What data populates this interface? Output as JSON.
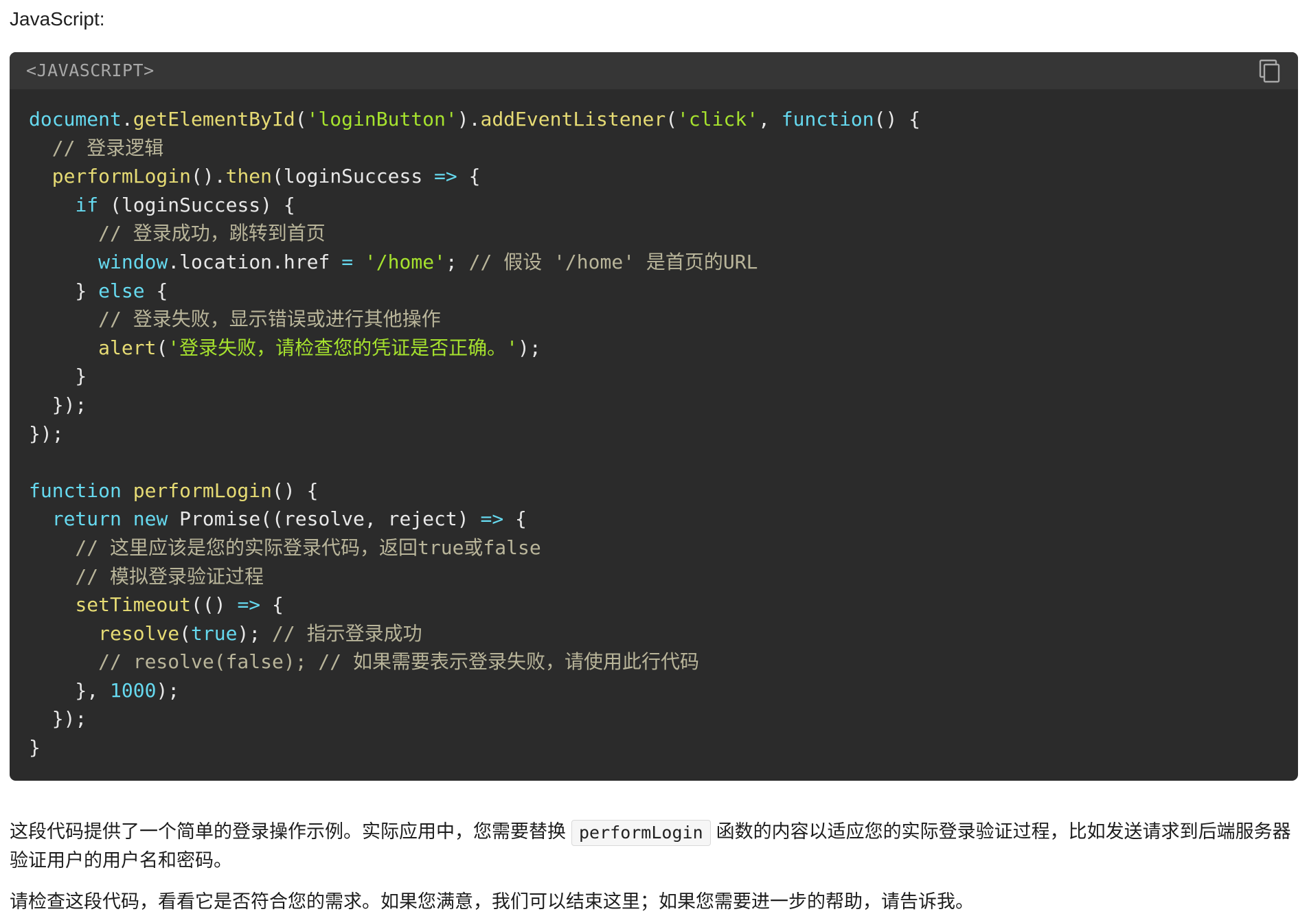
{
  "header": {
    "language_intro": "JavaScript:"
  },
  "code_block": {
    "language_label": "<JAVASCRIPT>",
    "copy_icon": "copy-icon",
    "lines": [
      [
        {
          "text": "document",
          "role": "blue"
        },
        {
          "text": ".",
          "role": "default"
        },
        {
          "text": "getElementById",
          "role": "yellow"
        },
        {
          "text": "(",
          "role": "default"
        },
        {
          "text": "'loginButton'",
          "role": "green"
        },
        {
          "text": ").",
          "role": "default"
        },
        {
          "text": "addEventListener",
          "role": "yellow"
        },
        {
          "text": "(",
          "role": "default"
        },
        {
          "text": "'click'",
          "role": "green"
        },
        {
          "text": ", ",
          "role": "default"
        },
        {
          "text": "function",
          "role": "blue"
        },
        {
          "text": "() {",
          "role": "default"
        }
      ],
      [
        {
          "text": "  // 登录逻辑",
          "role": "comment"
        }
      ],
      [
        {
          "text": "  ",
          "role": "default"
        },
        {
          "text": "performLogin",
          "role": "yellow"
        },
        {
          "text": "().",
          "role": "default"
        },
        {
          "text": "then",
          "role": "yellow"
        },
        {
          "text": "(loginSuccess ",
          "role": "default"
        },
        {
          "text": "=>",
          "role": "blue"
        },
        {
          "text": " {",
          "role": "default"
        }
      ],
      [
        {
          "text": "    ",
          "role": "default"
        },
        {
          "text": "if",
          "role": "blue"
        },
        {
          "text": " (loginSuccess) {",
          "role": "default"
        }
      ],
      [
        {
          "text": "      // 登录成功，跳转到首页",
          "role": "comment"
        }
      ],
      [
        {
          "text": "      ",
          "role": "default"
        },
        {
          "text": "window",
          "role": "blue"
        },
        {
          "text": ".location.href ",
          "role": "default"
        },
        {
          "text": "=",
          "role": "blue"
        },
        {
          "text": " ",
          "role": "default"
        },
        {
          "text": "'/home'",
          "role": "green"
        },
        {
          "text": "; ",
          "role": "default"
        },
        {
          "text": "// 假设 '/home' 是首页的URL",
          "role": "comment"
        }
      ],
      [
        {
          "text": "    } ",
          "role": "default"
        },
        {
          "text": "else",
          "role": "blue"
        },
        {
          "text": " {",
          "role": "default"
        }
      ],
      [
        {
          "text": "      // 登录失败，显示错误或进行其他操作",
          "role": "comment"
        }
      ],
      [
        {
          "text": "      ",
          "role": "default"
        },
        {
          "text": "alert",
          "role": "yellow"
        },
        {
          "text": "(",
          "role": "default"
        },
        {
          "text": "'登录失败，请检查您的凭证是否正确。'",
          "role": "green"
        },
        {
          "text": ");",
          "role": "default"
        }
      ],
      [
        {
          "text": "    }",
          "role": "default"
        }
      ],
      [
        {
          "text": "  });",
          "role": "default"
        }
      ],
      [
        {
          "text": "});",
          "role": "default"
        }
      ],
      [
        {
          "text": "",
          "role": "default"
        }
      ],
      [
        {
          "text": "function",
          "role": "blue"
        },
        {
          "text": " ",
          "role": "default"
        },
        {
          "text": "performLogin",
          "role": "yellow"
        },
        {
          "text": "() {",
          "role": "default"
        }
      ],
      [
        {
          "text": "  ",
          "role": "default"
        },
        {
          "text": "return",
          "role": "blue"
        },
        {
          "text": " ",
          "role": "default"
        },
        {
          "text": "new",
          "role": "blue"
        },
        {
          "text": " Promise((resolve, reject) ",
          "role": "default"
        },
        {
          "text": "=>",
          "role": "blue"
        },
        {
          "text": " {",
          "role": "default"
        }
      ],
      [
        {
          "text": "    // 这里应该是您的实际登录代码，返回true或false",
          "role": "comment"
        }
      ],
      [
        {
          "text": "    // 模拟登录验证过程",
          "role": "comment"
        }
      ],
      [
        {
          "text": "    ",
          "role": "default"
        },
        {
          "text": "setTimeout",
          "role": "yellow"
        },
        {
          "text": "(() ",
          "role": "default"
        },
        {
          "text": "=>",
          "role": "blue"
        },
        {
          "text": " {",
          "role": "default"
        }
      ],
      [
        {
          "text": "      ",
          "role": "default"
        },
        {
          "text": "resolve",
          "role": "yellow"
        },
        {
          "text": "(",
          "role": "default"
        },
        {
          "text": "true",
          "role": "blue"
        },
        {
          "text": "); ",
          "role": "default"
        },
        {
          "text": "// 指示登录成功",
          "role": "comment"
        }
      ],
      [
        {
          "text": "      // resolve(false); // 如果需要表示登录失败，请使用此行代码",
          "role": "comment"
        }
      ],
      [
        {
          "text": "    }, ",
          "role": "default"
        },
        {
          "text": "1000",
          "role": "number"
        },
        {
          "text": ");",
          "role": "default"
        }
      ],
      [
        {
          "text": "  });",
          "role": "default"
        }
      ],
      [
        {
          "text": "}",
          "role": "default"
        }
      ]
    ]
  },
  "content": {
    "paragraph_1_before": "这段代码提供了一个简单的登录操作示例。实际应用中，您需要替换",
    "inline_function_name": "performLogin",
    "paragraph_1_after": "函数的内容以适应您的实际登录验证过程，比如发送请求到后端服务器验证用户的用户名和密码。",
    "paragraph_2": "请检查这段代码，看看它是否符合您的需求。如果您满意，我们可以结束这里；如果您需要进一步的帮助，请告诉我。"
  }
}
